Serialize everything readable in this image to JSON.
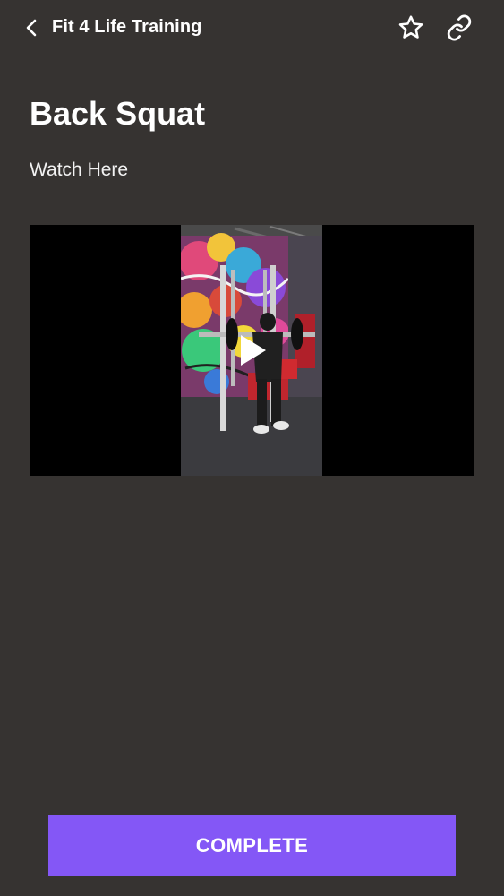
{
  "header": {
    "title": "Fit 4 Life Training",
    "back_icon": "chevron-left-icon",
    "favorite_icon": "star-outline-icon",
    "share_icon": "link-icon"
  },
  "main": {
    "title": "Back Squat",
    "subtitle": "Watch Here",
    "video": {
      "play_icon": "play-icon"
    }
  },
  "footer": {
    "complete_label": "COMPLETE"
  },
  "colors": {
    "background": "#363331",
    "accent": "#8457f6",
    "text": "#ffffff",
    "video_background": "#000000"
  }
}
